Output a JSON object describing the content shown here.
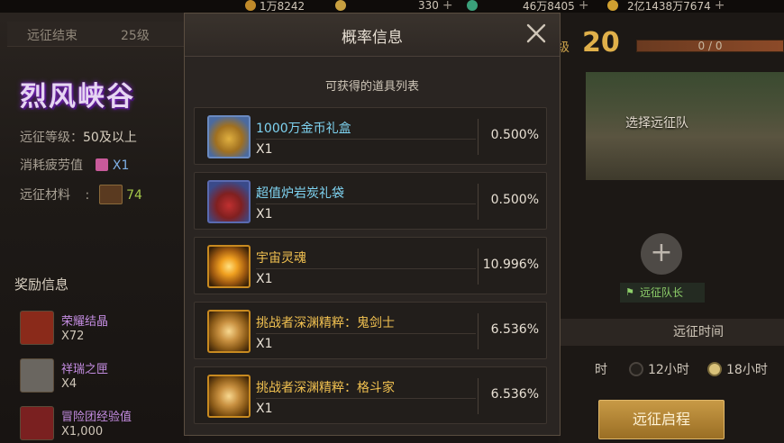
{
  "topbar": {
    "currencies": [
      {
        "value": "1万8242",
        "color": "#c08a2a"
      },
      {
        "value": "330",
        "color": "#c8a040"
      },
      {
        "value": "46万8405",
        "color": "#3aa07a"
      },
      {
        "value": "2亿1438万7674",
        "color": "#d0a030"
      }
    ],
    "plus_label": "+"
  },
  "left": {
    "status_end": "远征结束",
    "status_level": "25级",
    "stage_title": "烈风峡谷",
    "req_level_label": "远征等级：",
    "req_level_value": "50及以上",
    "fatigue_label": "消耗疲劳值",
    "fatigue_value": "X1",
    "material_label": "远征材料",
    "material_colon": ":",
    "material_value": "74",
    "reward_title": "奖励信息",
    "rewards": [
      {
        "name": "荣耀结晶",
        "qty": "X72",
        "icon": "trophy-icon",
        "color": "#8a2a1a"
      },
      {
        "name": "祥瑞之匣",
        "qty": "X4",
        "icon": "box-icon",
        "color": "#6a6660"
      },
      {
        "name": "冒险团经验值",
        "qty": "X1,000",
        "icon": "exp-scroll-icon",
        "color": "#7a2020"
      }
    ]
  },
  "right": {
    "level_label": "级",
    "level_num": "20",
    "progress_text": "0 / 0",
    "progress": 0,
    "select_team": "选择远征队",
    "add_label": "+",
    "leader_label": "远征队长",
    "time_title": "远征时间",
    "time_options": [
      "时",
      "12小时",
      "18小时"
    ],
    "time_selected": "18小时",
    "start_button": "远征启程"
  },
  "modal": {
    "title": "概率信息",
    "subtitle": "可获得的道具列表",
    "items": [
      {
        "name": "1000万金币礼盒",
        "qty": "X1",
        "pct": "0.500%",
        "name_color": "blue",
        "icon": "gold-chest-icon",
        "bg": "#4a6aa0"
      },
      {
        "name": "超值炉岩炭礼袋",
        "qty": "X1",
        "pct": "0.500%",
        "name_color": "blue",
        "icon": "gift-bag-icon",
        "bg": "#3a4a8a"
      },
      {
        "name": "宇宙灵魂",
        "qty": "X1",
        "pct": "10.996%",
        "name_color": "gold",
        "icon": "cosmic-soul-icon",
        "bg": "#a05a10"
      },
      {
        "name": "挑战者深渊精粹：鬼剑士",
        "qty": "X1",
        "pct": "6.536%",
        "name_color": "gold",
        "icon": "abyss-essence-icon",
        "bg": "#8a5a18"
      },
      {
        "name": "挑战者深渊精粹：格斗家",
        "qty": "X1",
        "pct": "6.536%",
        "name_color": "gold",
        "icon": "abyss-essence-icon",
        "bg": "#8a5a18"
      }
    ]
  }
}
